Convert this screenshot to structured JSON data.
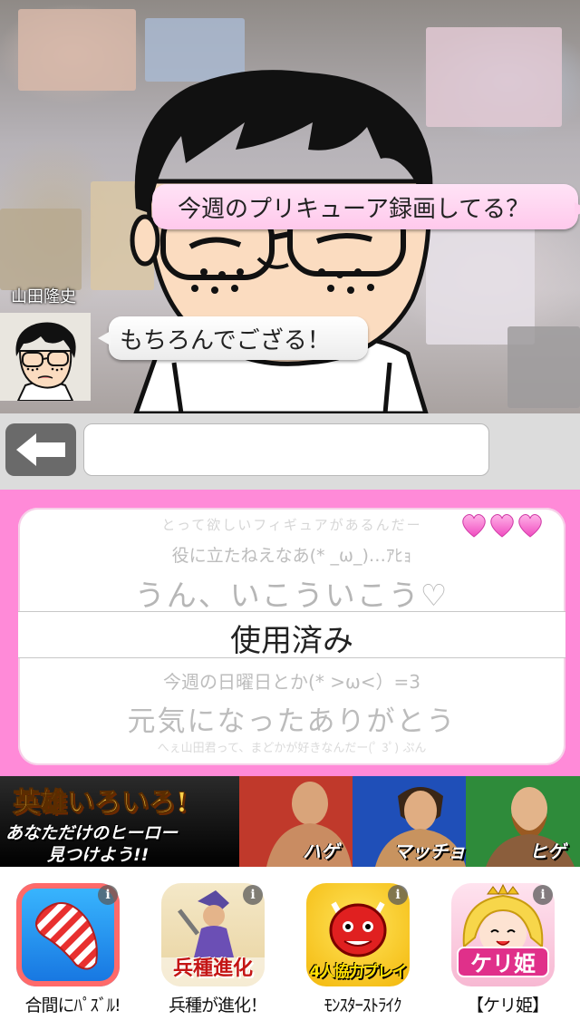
{
  "chat": {
    "partner_message": "今週のプリキューア録画してる？",
    "speaker_name": "山田隆史",
    "reply_message": "もちろんでござる！"
  },
  "input": {
    "value": "",
    "back_icon": "left-arrow-icon"
  },
  "picker": {
    "items": [
      "とって欲しいフィギュアがあるんだー",
      "役に立たねえなあ(* _ω_)…ｱﾋｮ",
      "うん、いこういこう♡",
      "使用済み",
      "今週の日曜日とか(* >ω<）=3",
      "元気になったありがとう",
      "へぇ山田君って、まどかが好きなんだー(ﾟ 3ﾟ) ぷん"
    ],
    "selected_index": 3,
    "decoration": "hearts-icon",
    "colors": {
      "frame": "#ff8ad8",
      "faded_text": "#b8b8b8",
      "selected_text": "#222222"
    }
  },
  "banner": {
    "title": "英雄いろいろ!",
    "subtitle_line1": "あなただけのヒーロー",
    "subtitle_line2": "見つけよう!!",
    "heroes": [
      "ハゲ",
      "マッチョ",
      "ヒゲ"
    ]
  },
  "apps": [
    {
      "label": "合間にﾊﾟｽﾞﾙ!",
      "icon": "candy-icon"
    },
    {
      "label": "兵種が進化！",
      "icon": "ninja-warrior-icon",
      "icon_text": "兵種進化"
    },
    {
      "label": "ﾓﾝｽﾀｰｽﾄﾗｲｸ",
      "icon": "red-demon-icon",
      "icon_text": "4人協力プレイ"
    },
    {
      "label": "【ケリ姫】",
      "icon": "princess-icon",
      "icon_text": "ケリ姫"
    }
  ],
  "info_glyph": "i"
}
